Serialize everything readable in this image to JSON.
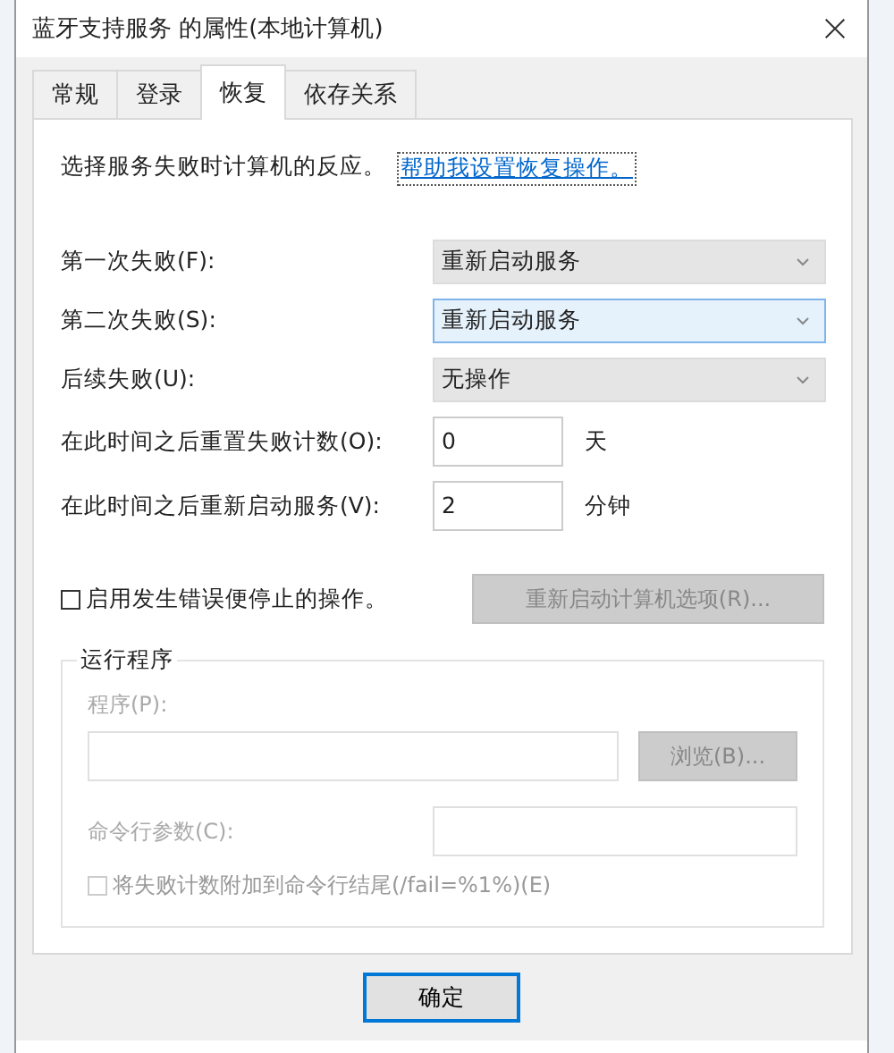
{
  "window": {
    "title": "蓝牙支持服务 的属性(本地计算机)"
  },
  "tabs": [
    {
      "label": "常规",
      "selected": false
    },
    {
      "label": "登录",
      "selected": false
    },
    {
      "label": "恢复",
      "selected": true
    },
    {
      "label": "依存关系",
      "selected": false
    }
  ],
  "intro": {
    "text": "选择服务失败时计算机的反应。",
    "link": "帮助我设置恢复操作。"
  },
  "rows": [
    {
      "kind": "combo",
      "label": "第一次失败(F):",
      "value": "重新启动服务",
      "focused": false
    },
    {
      "kind": "combo",
      "label": "第二次失败(S):",
      "value": "重新启动服务",
      "focused": true
    },
    {
      "kind": "combo",
      "label": "后续失败(U):",
      "value": "无操作",
      "focused": false
    },
    {
      "kind": "number",
      "label": "在此时间之后重置失败计数(O):",
      "value": "0",
      "unit": "天"
    },
    {
      "kind": "number",
      "label": "在此时间之后重新启动服务(V):",
      "value": "2",
      "unit": "分钟"
    }
  ],
  "stop_option": {
    "label": "启用发生错误便停止的操作。",
    "checked": false
  },
  "restart_computer_button": {
    "label": "重新启动计算机选项(R)...",
    "disabled": true
  },
  "run_program": {
    "legend": "运行程序",
    "program_label": "程序(P):",
    "browse_button": {
      "label": "浏览(B)...",
      "disabled": true
    },
    "params_label": "命令行参数(C):",
    "append_option": {
      "label": "将失败计数附加到命令行结尾(/fail=%1%)(E)",
      "checked": false,
      "disabled": true
    },
    "disabled": true
  },
  "buttons": [
    {
      "label": "确定",
      "default": true
    }
  ]
}
